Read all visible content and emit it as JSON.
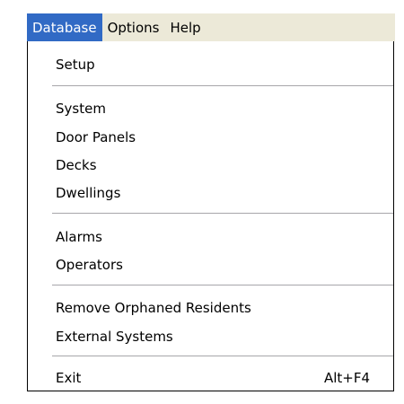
{
  "menubar": {
    "items": [
      {
        "label": "Database",
        "active": true
      },
      {
        "label": "Options",
        "active": false
      },
      {
        "label": "Help",
        "active": false
      }
    ]
  },
  "menu": {
    "setup": "Setup",
    "system": "System",
    "door_panels": "Door Panels",
    "decks": "Decks",
    "dwellings": "Dwellings",
    "alarms": "Alarms",
    "operators": "Operators",
    "remove_orphaned_residents": "Remove Orphaned Residents",
    "external_systems": "External Systems",
    "exit": "Exit",
    "exit_shortcut": "Alt+F4"
  },
  "colors": {
    "menubar_background": "#ece9d8",
    "highlight": "#316ac5",
    "separator": "#a7a6aa"
  }
}
